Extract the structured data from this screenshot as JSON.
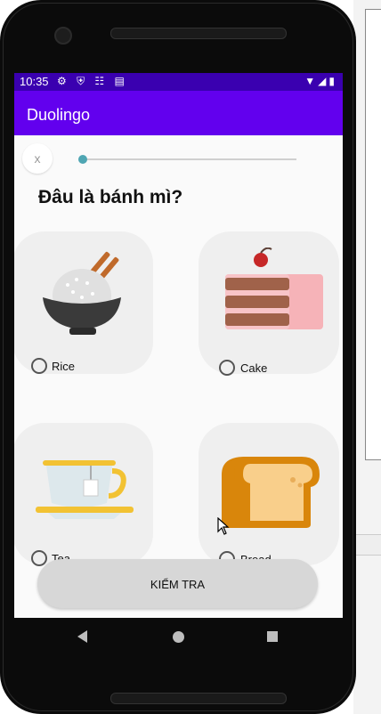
{
  "status_bar": {
    "time": "10:35",
    "left_icons": "⚙ ⛨ ☷ ▤",
    "right_icons": "▼◢▮"
  },
  "app_bar": {
    "title": "Duolingo"
  },
  "close_button": {
    "label": "x"
  },
  "progress": {
    "value": 0.0
  },
  "question": "Đâu là bánh mì?",
  "options": [
    {
      "label": "Rice",
      "icon": "rice-bowl-icon",
      "selected": false
    },
    {
      "label": "Cake",
      "icon": "cake-icon",
      "selected": false
    },
    {
      "label": "Tea",
      "icon": "tea-cup-icon",
      "selected": false
    },
    {
      "label": "Bread",
      "icon": "bread-icon",
      "selected": false
    }
  ],
  "check_button": {
    "label": "KIỂM TRA"
  },
  "colors": {
    "app_bar": "#6200ee",
    "status_bar": "#3a00b0",
    "slider_thumb": "#4fa6b3",
    "card": "#efefef",
    "button": "#d7d7d7"
  }
}
